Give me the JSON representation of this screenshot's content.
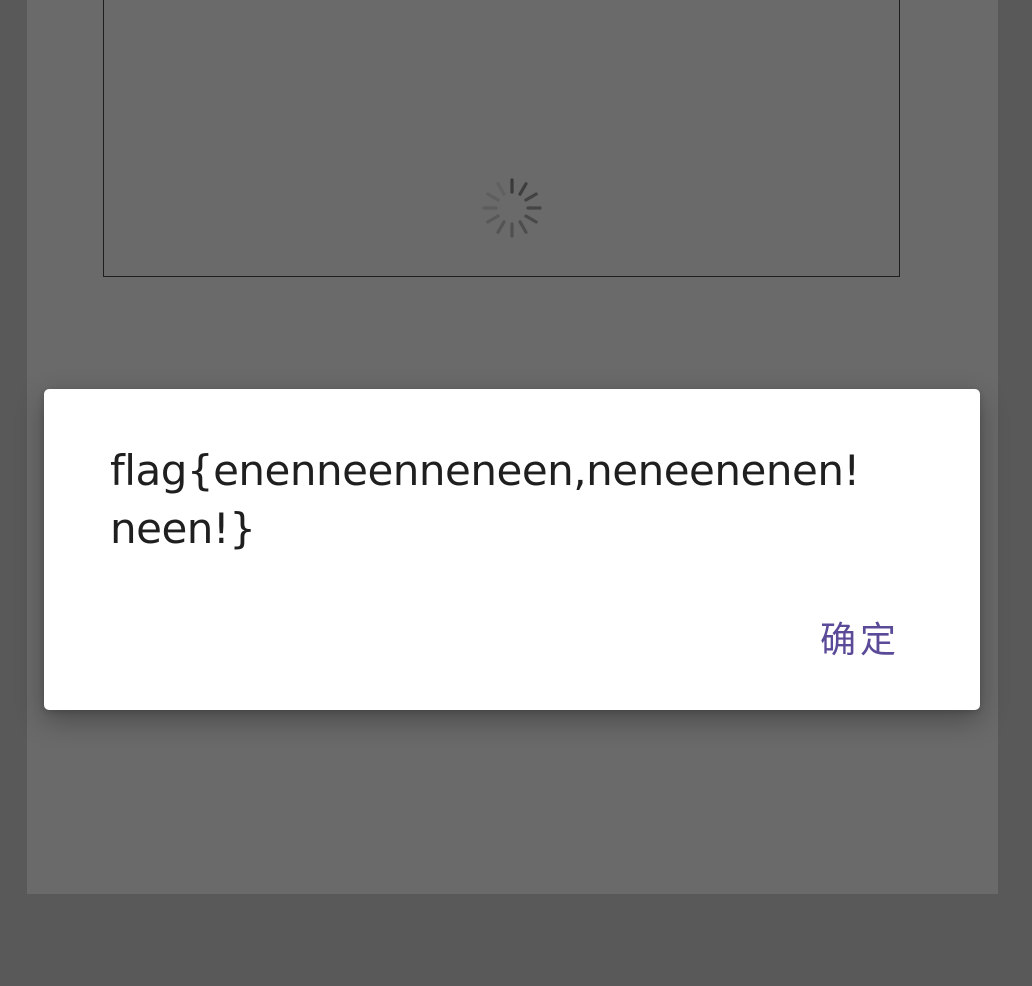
{
  "dialog": {
    "message": "flag{enenneenneneen,neneenenen!neen!}",
    "confirm_label": "确定"
  },
  "colors": {
    "backdrop": "#595959",
    "panel": "#6a6a6a",
    "dialog_background": "#ffffff",
    "message_text": "#1f1f1f",
    "accent": "#5b4a98"
  },
  "icons": {
    "loading": "loading-spinner-icon"
  }
}
